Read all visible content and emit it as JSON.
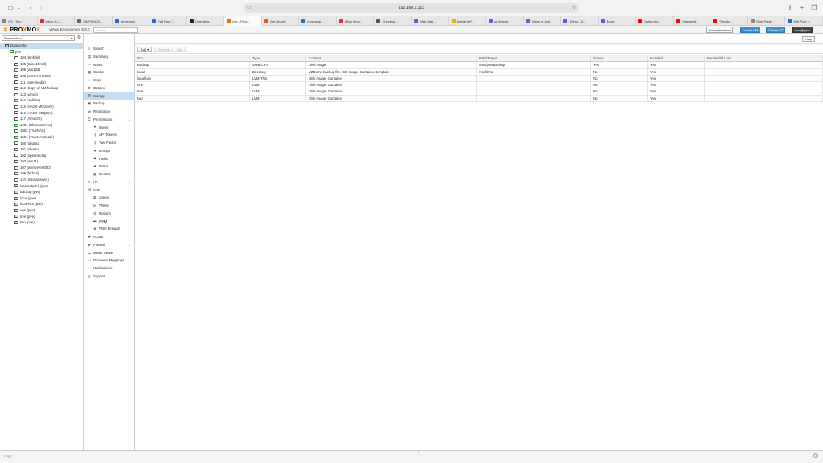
{
  "browser": {
    "url": "192.168.1.153",
    "tabs": [
      {
        "label": "OS - Top...",
        "color": "#888888"
      },
      {
        "label": "Inbox (1,2...",
        "color": "#d93025"
      },
      {
        "label": "SIMPLINDS...",
        "color": "#666666"
      },
      {
        "label": "Nextcloud...",
        "color": "#1e70c7"
      },
      {
        "label": "Edit Post \"...",
        "color": "#1e70c7"
      },
      {
        "label": "Operating...",
        "color": "#222222"
      },
      {
        "label": "pve - Prox...",
        "color": "#e57000"
      },
      {
        "label": "Get Ubunt...",
        "color": "#e95420"
      },
      {
        "label": "Download...",
        "color": "#1e70c7"
      },
      {
        "label": "eBay shop...",
        "color": "#e53238"
      },
      {
        "label": "Checkout...",
        "color": "#555555"
      },
      {
        "label": "Web Stati...",
        "color": "#7a4fd9"
      },
      {
        "label": "Dexter's P...",
        "color": "#e5b400"
      },
      {
        "label": "of Jicama",
        "color": "#7a4fd9"
      },
      {
        "label": "Video of Jad",
        "color": "#7a4fd9"
      },
      {
        "label": "10k.ru - Д...",
        "color": "#7a4fd9"
      },
      {
        "label": "Booq",
        "color": "#7a4fd9"
      },
      {
        "label": "Subscripti...",
        "color": "#ff0000"
      },
      {
        "label": "Channel d...",
        "color": "#ff0000"
      },
      {
        "label": "(Trendy ...",
        "color": "#ff0000"
      },
      {
        "label": "Start Page",
        "color": "#888888"
      },
      {
        "label": "Edit Post ‹...",
        "color": "#1e70c7"
      }
    ],
    "active_tab": 6
  },
  "pve": {
    "logo_a": "PRO",
    "logo_x1": "X",
    "logo_b": "MO",
    "logo_x2": "X",
    "version": "Virtual Environment 8.3.0",
    "search_placeholder": "Search",
    "btn_docs": "Documentation",
    "btn_create_vm": "Create VM",
    "btn_create_ct": "Create CT",
    "btn_user": "root@pam",
    "btn_help": "Help"
  },
  "tree": {
    "view": "Server View",
    "nodes": [
      {
        "label": "Datacenter",
        "indent": 1,
        "icon": "dc",
        "selected": true
      },
      {
        "label": "pve",
        "indent": 2,
        "icon": "srv",
        "selected": false
      },
      {
        "label": "104 (pmhole)",
        "indent": 3,
        "icon": "vm",
        "selected": false
      },
      {
        "label": "105 (Win11Prod)",
        "indent": 3,
        "icon": "vm",
        "selected": false
      },
      {
        "label": "106 (win123)",
        "indent": 3,
        "icon": "vm",
        "selected": false
      },
      {
        "label": "108 (winserver2022)",
        "indent": 3,
        "icon": "vm",
        "selected": false
      },
      {
        "label": "111 (openmedia)",
        "indent": 3,
        "icon": "vm",
        "selected": false
      },
      {
        "label": "112 (Copy-of-VM-fedora)",
        "indent": 3,
        "icon": "vm",
        "selected": false
      },
      {
        "label": "113 (winxp)",
        "indent": 3,
        "icon": "vm",
        "selected": false
      },
      {
        "label": "114 (Kalihux)",
        "indent": 3,
        "icon": "run",
        "selected": false
      },
      {
        "label": "115 (HACK-MOJAVE)",
        "indent": 3,
        "icon": "vm",
        "selected": false
      },
      {
        "label": "116 (HACK-SEQUIA)",
        "indent": 3,
        "icon": "vm",
        "selected": false
      },
      {
        "label": "117 (AlmaOS)",
        "indent": 3,
        "icon": "vm",
        "selected": false
      },
      {
        "label": "1001 (UbuntuServer)",
        "indent": 3,
        "icon": "run",
        "selected": false
      },
      {
        "label": "1002 (TrueNAS)",
        "indent": 3,
        "icon": "vm",
        "selected": false
      },
      {
        "label": "1004 (TrueNASScale)",
        "indent": 3,
        "icon": "run",
        "selected": false
      },
      {
        "label": "100 (ubuntu)",
        "indent": 3,
        "icon": "vm",
        "selected": false
      },
      {
        "label": "101 (ubuntu)",
        "indent": 3,
        "icon": "vm",
        "selected": false
      },
      {
        "label": "102 (openmedia)",
        "indent": 3,
        "icon": "vm",
        "selected": false
      },
      {
        "label": "103 (win11)",
        "indent": 3,
        "icon": "vm",
        "selected": false
      },
      {
        "label": "107 (winserver2022)",
        "indent": 3,
        "icon": "vm",
        "selected": false
      },
      {
        "label": "109 (fedora)",
        "indent": 3,
        "icon": "vm",
        "selected": false
      },
      {
        "label": "110 (fedoraServer)",
        "indent": 3,
        "icon": "vm",
        "selected": false
      },
      {
        "label": "localnetwork (pve)",
        "indent": 3,
        "icon": "stor",
        "selected": false
      },
      {
        "label": "Backup (pve)",
        "indent": 3,
        "icon": "stor",
        "selected": false
      },
      {
        "label": "local (pve)",
        "indent": 3,
        "icon": "stor",
        "selected": false
      },
      {
        "label": "local-lvm (pve)",
        "indent": 3,
        "icon": "stor",
        "selected": false
      },
      {
        "label": "one (pve)",
        "indent": 3,
        "icon": "stor",
        "selected": false
      },
      {
        "label": "tree (pve)",
        "indent": 3,
        "icon": "stor",
        "selected": false
      },
      {
        "label": "two (pve)",
        "indent": 3,
        "icon": "stor",
        "selected": false
      }
    ]
  },
  "panel_title": "Datacenter",
  "nav": [
    {
      "label": "Search",
      "sub": false,
      "icon": "search-icon",
      "glyph": "⌕"
    },
    {
      "label": "Summary",
      "sub": false,
      "icon": "book-icon",
      "glyph": "▤"
    },
    {
      "label": "Notes",
      "sub": false,
      "icon": "notes-icon",
      "glyph": "▭"
    },
    {
      "label": "Cluster",
      "sub": false,
      "icon": "server-icon",
      "glyph": "▦"
    },
    {
      "label": "Ceph",
      "sub": false,
      "icon": "ceph-icon",
      "glyph": "◌"
    },
    {
      "label": "Options",
      "sub": false,
      "icon": "gear-icon",
      "glyph": "⚙"
    },
    {
      "label": "Storage",
      "sub": false,
      "icon": "database-icon",
      "glyph": "▥",
      "selected": true
    },
    {
      "label": "Backup",
      "sub": false,
      "icon": "floppy-icon",
      "glyph": "▣"
    },
    {
      "label": "Replication",
      "sub": false,
      "icon": "retweet-icon",
      "glyph": "⇄"
    },
    {
      "label": "Permissions",
      "sub": false,
      "icon": "unlock-icon",
      "glyph": "⚿",
      "expander": true
    },
    {
      "label": "Users",
      "sub": true,
      "icon": "user-icon",
      "glyph": "●"
    },
    {
      "label": "API Tokens",
      "sub": true,
      "icon": "key-icon",
      "glyph": "⚷"
    },
    {
      "label": "Two Factor",
      "sub": true,
      "icon": "key-icon",
      "glyph": "⚷"
    },
    {
      "label": "Groups",
      "sub": true,
      "icon": "users-icon",
      "glyph": "●"
    },
    {
      "label": "Pools",
      "sub": true,
      "icon": "tags-icon",
      "glyph": "◆"
    },
    {
      "label": "Roles",
      "sub": true,
      "icon": "male-icon",
      "glyph": "♟"
    },
    {
      "label": "Realms",
      "sub": true,
      "icon": "building-icon",
      "glyph": "▦"
    },
    {
      "label": "HA",
      "sub": false,
      "icon": "heartbeat-icon",
      "glyph": "♥",
      "expander": true
    },
    {
      "label": "SDN",
      "sub": false,
      "icon": "sdn-icon",
      "glyph": "⋈",
      "expander": true
    },
    {
      "label": "Zones",
      "sub": true,
      "icon": "th-icon",
      "glyph": "▦"
    },
    {
      "label": "VNets",
      "sub": true,
      "icon": "network-icon",
      "glyph": "⋈"
    },
    {
      "label": "Options",
      "sub": true,
      "icon": "gear-icon",
      "glyph": "⚙"
    },
    {
      "label": "IPAM",
      "sub": true,
      "icon": "ipam-icon",
      "glyph": "▬"
    },
    {
      "label": "VNet Firewall",
      "sub": true,
      "icon": "shield-icon",
      "glyph": "◈"
    },
    {
      "label": "ACME",
      "sub": false,
      "icon": "certificate-icon",
      "glyph": "✺"
    },
    {
      "label": "Firewall",
      "sub": false,
      "icon": "shield-icon",
      "glyph": "◈",
      "expander": true
    },
    {
      "label": "Metric Server",
      "sub": false,
      "icon": "chart-icon",
      "glyph": "▁"
    },
    {
      "label": "Resource Mappings",
      "sub": false,
      "icon": "folder-icon",
      "glyph": "▭"
    },
    {
      "label": "Notifications",
      "sub": false,
      "icon": "bell-icon",
      "glyph": "◔"
    },
    {
      "label": "Support",
      "sub": false,
      "icon": "support-icon",
      "glyph": "◎"
    }
  ],
  "storage": {
    "btn_add": "Add",
    "btn_remove": "Remove",
    "btn_edit": "Edit",
    "columns": [
      "ID ↑",
      "Type",
      "Content",
      "Path/Target",
      "Shared",
      "Enabled",
      "Bandwidth Limit"
    ],
    "rows": [
      [
        "Backup",
        "SMB/CIFS",
        "Disk image",
        "/mnt/pve/Backup",
        "Yes",
        "Yes",
        ""
      ],
      [
        "local",
        "Directory",
        "VZDump backup file, ISO image, Container template",
        "/var/lib/vz",
        "No",
        "Yes",
        ""
      ],
      [
        "local-lvm",
        "LVM-Thin",
        "Disk image, Container",
        "",
        "No",
        "Yes",
        ""
      ],
      [
        "one",
        "LVM",
        "Disk image, Container",
        "",
        "No",
        "Yes",
        ""
      ],
      [
        "tree",
        "LVM",
        "Disk image, Container",
        "",
        "No",
        "Yes",
        ""
      ],
      [
        "two",
        "LVM",
        "Disk image, Container",
        "",
        "No",
        "Yes",
        ""
      ]
    ]
  },
  "footer": {
    "logs": "Logs"
  }
}
